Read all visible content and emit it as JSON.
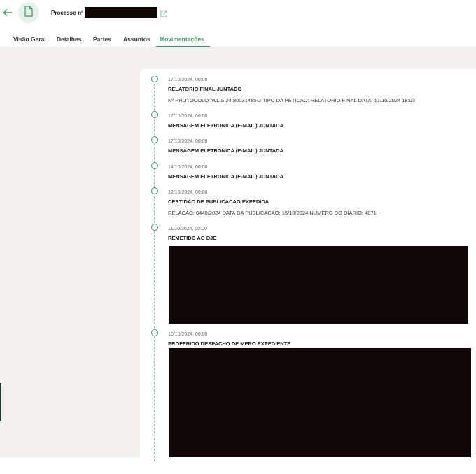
{
  "header": {
    "process_label": "Processo nº",
    "process_number": "█████████"
  },
  "tabs": [
    {
      "label": "Visão Geral",
      "active": false
    },
    {
      "label": "Detalhes",
      "active": false
    },
    {
      "label": "Partes",
      "active": false
    },
    {
      "label": "Assuntos",
      "active": false
    },
    {
      "label": "Movimentações",
      "active": true
    }
  ],
  "colors": {
    "accent": "#3a9a68",
    "background": "#f2f1ed",
    "redaction": "#0f0606"
  },
  "icons": [
    "back-arrow-icon",
    "document-icon",
    "external-link-icon"
  ],
  "movements": [
    {
      "date": "17/10/2024, 00:00",
      "title": "RELATORIO FINAL JUNTADO",
      "detail": "Nº PROTOCOLO: WLIS.24.80031485-2 TIPO DA PETICAO: RELATORIO FINAL DATA: 17/10/2024 18:03"
    },
    {
      "date": "17/10/2024, 00:00",
      "title": "MENSAGEM ELETRONICA (E-MAIL) JUNTADA"
    },
    {
      "date": "17/10/2024, 00:00",
      "title": "MENSAGEM ELETRONICA (E-MAIL) JUNTADA"
    },
    {
      "date": "14/10/2024, 00:00",
      "title": "MENSAGEM ELETRONICA (E-MAIL) JUNTADA"
    },
    {
      "date": "12/10/2024, 00:00",
      "title": "CERTIDAO DE PUBLICACAO EXPEDIDA",
      "detail": "RELACAO: 0440/2024 DATA DA PUBLICACAO: 15/10/2024 NUMERO DO DIARIO: 4071"
    },
    {
      "date": "11/10/2024, 00:00",
      "title": "REMETIDO AO DJE"
    },
    {
      "date": "10/10/2024, 00:00",
      "title": "PROFERIDO DESPACHO DE MERO EXPEDIENTE"
    }
  ]
}
